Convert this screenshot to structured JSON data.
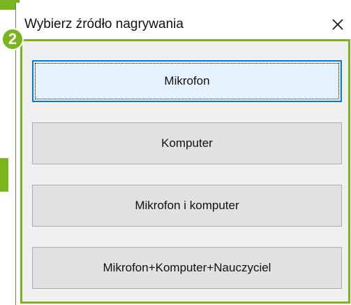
{
  "dialog": {
    "title": "Wybierz źródło nagrywania",
    "close_icon": "close-icon",
    "buttons": [
      {
        "label": "Mikrofon",
        "focused": true
      },
      {
        "label": "Komputer",
        "focused": false
      },
      {
        "label": "Mikrofon i komputer",
        "focused": false
      },
      {
        "label": "Mikrofon+Komputer+Nauczyciel",
        "focused": false
      }
    ]
  },
  "annotation": {
    "badge_number": "2",
    "accent_color": "#7ab51d"
  },
  "colors": {
    "focus_border": "#0078d7",
    "button_bg": "#e1e1e1",
    "content_bg": "#f0f0f0"
  }
}
